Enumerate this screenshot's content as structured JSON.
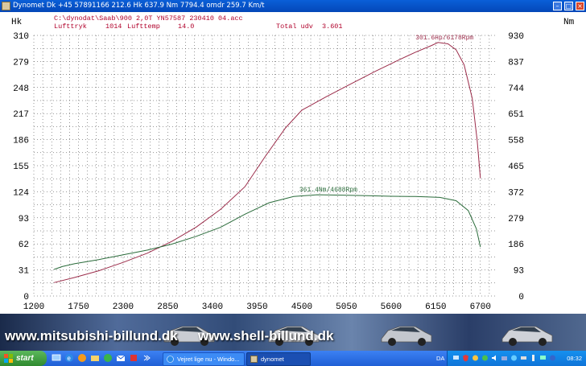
{
  "window": {
    "title": "Dynomet Dk +45 57891166  212.6 Hk 637.9 Nm 7794.4 omdr 259.7 Km/t",
    "icon": "dynomet-app-icon"
  },
  "chart_header": {
    "file": "C:\\dynodat\\Saab\\900 2,0T YN57587 230410 04.acc",
    "pressure_label": "Lufttryk",
    "pressure_value": "1014",
    "temp_label": "Lufttemp",
    "temp_value": "14.0",
    "total_label": "Total udv",
    "total_value": "3.601"
  },
  "chart_data": {
    "type": "line",
    "xlim": [
      1200,
      6900
    ],
    "x_ticks": [
      1200,
      1750,
      2300,
      2850,
      3400,
      3950,
      4500,
      5050,
      5600,
      6150,
      6700
    ],
    "y_left": {
      "label": "Hk",
      "ticks": [
        0,
        31,
        62,
        93,
        124,
        155,
        186,
        217,
        248,
        279,
        310
      ],
      "lim": [
        0,
        310
      ]
    },
    "y_right": {
      "label": "Nm",
      "ticks": [
        0,
        93,
        186,
        279,
        372,
        465,
        558,
        651,
        744,
        837,
        930
      ],
      "lim": [
        0,
        930
      ]
    },
    "grid": true,
    "series": [
      {
        "axis": "left",
        "color": "#9b2c4a",
        "peak_label": "301.6Hp/6178Rpm",
        "points": [
          [
            1450,
            16
          ],
          [
            1700,
            22
          ],
          [
            2000,
            30
          ],
          [
            2300,
            40
          ],
          [
            2600,
            51
          ],
          [
            2900,
            65
          ],
          [
            3200,
            82
          ],
          [
            3500,
            103
          ],
          [
            3800,
            130
          ],
          [
            4050,
            166
          ],
          [
            4300,
            200
          ],
          [
            4500,
            221
          ],
          [
            4800,
            237
          ],
          [
            5100,
            252
          ],
          [
            5400,
            267
          ],
          [
            5700,
            281
          ],
          [
            5900,
            290
          ],
          [
            6100,
            298
          ],
          [
            6178,
            301.6
          ],
          [
            6300,
            300
          ],
          [
            6400,
            293
          ],
          [
            6500,
            275
          ],
          [
            6600,
            235
          ],
          [
            6660,
            185
          ],
          [
            6700,
            140
          ]
        ]
      },
      {
        "axis": "right",
        "color": "#2a6b3a",
        "peak_label": "361.4Nm/4688Rpm",
        "points": [
          [
            1450,
            95
          ],
          [
            1550,
            105
          ],
          [
            1700,
            115
          ],
          [
            2000,
            130
          ],
          [
            2300,
            147
          ],
          [
            2600,
            164
          ],
          [
            2900,
            185
          ],
          [
            3200,
            213
          ],
          [
            3500,
            245
          ],
          [
            3800,
            292
          ],
          [
            4100,
            333
          ],
          [
            4400,
            355
          ],
          [
            4688,
            361.4
          ],
          [
            5000,
            360
          ],
          [
            5300,
            358
          ],
          [
            5600,
            356
          ],
          [
            5900,
            355
          ],
          [
            6200,
            352
          ],
          [
            6400,
            340
          ],
          [
            6550,
            305
          ],
          [
            6650,
            240
          ],
          [
            6700,
            175
          ]
        ]
      }
    ]
  },
  "banner": {
    "left_text": "www.mitsubishi-billund.dk",
    "right_text": "www.shell-billund.dk"
  },
  "taskbar": {
    "start_label": "start",
    "buttons": [
      {
        "label": "Vejret lige nu - Windo...",
        "icon": "ie-icon"
      },
      {
        "label": "dynomet",
        "icon": "dynomet-icon"
      }
    ],
    "language": "DA",
    "clock": "08:32"
  }
}
